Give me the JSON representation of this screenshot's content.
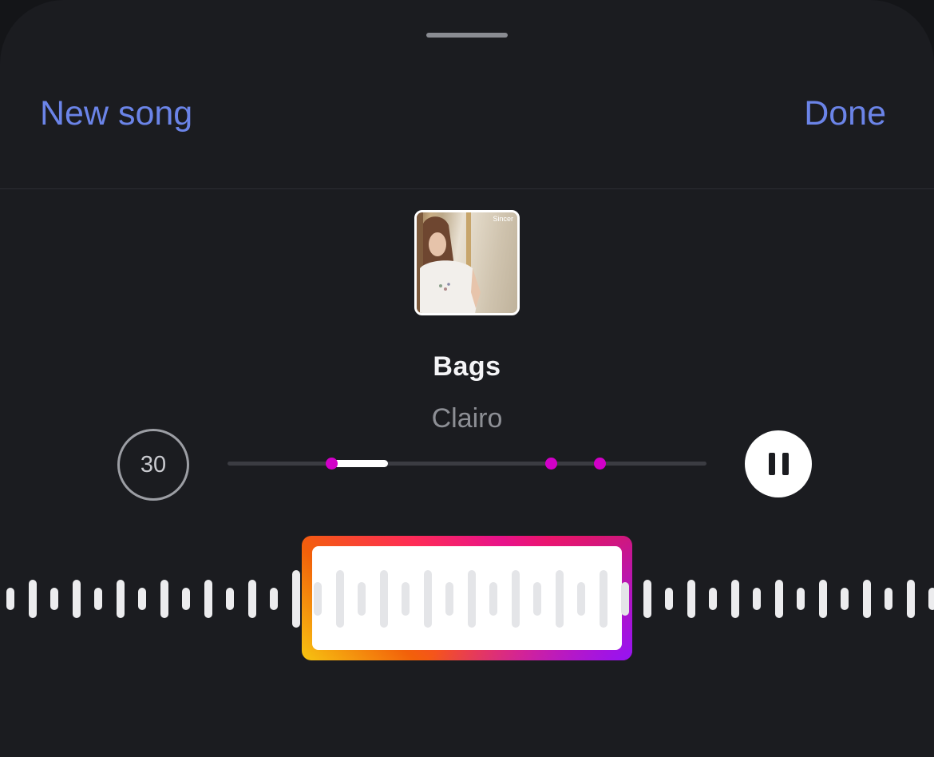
{
  "header": {
    "new_song_label": "New song",
    "done_label": "Done"
  },
  "track": {
    "album_art": "album-cover-photo",
    "album_tag": "Sincer",
    "title": "Bags",
    "artist": "Clairo"
  },
  "controls": {
    "clip_duration": "30",
    "playback_state": "playing",
    "pause_icon": "pause-icon",
    "selection": {
      "start": 0.22,
      "end": 0.335
    },
    "markers": [
      0.218,
      0.675,
      0.778
    ]
  },
  "colors": {
    "accent": "#6b84e8",
    "background": "#1b1c20",
    "marker": "#d100c8",
    "selector_gradient": [
      "#f7c511",
      "#f2600a",
      "#ff2d55",
      "#e8138a",
      "#8c14ff"
    ]
  }
}
